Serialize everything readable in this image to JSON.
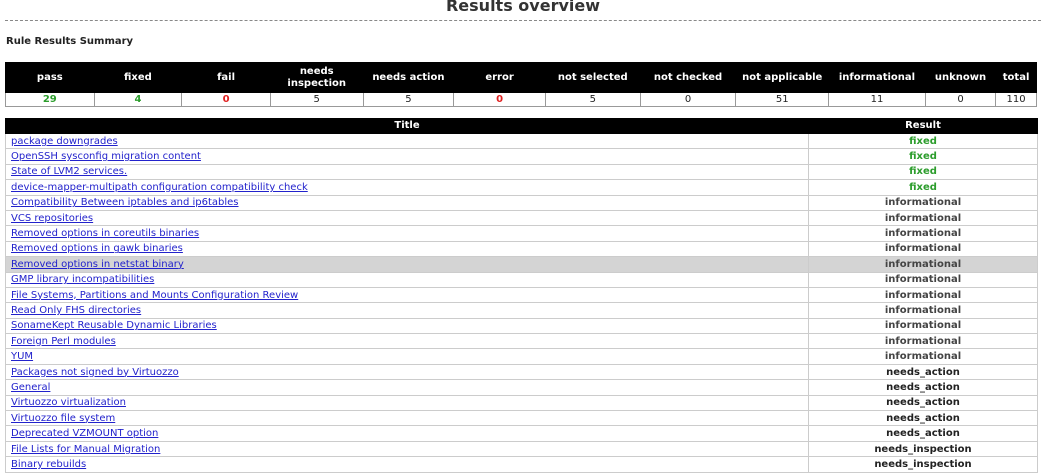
{
  "page": {
    "title": "Results overview"
  },
  "summary": {
    "title": "Rule Results Summary",
    "headers": [
      "pass",
      "fixed",
      "fail",
      "needs inspection",
      "needs action",
      "error",
      "not selected",
      "not checked",
      "not applicable",
      "informational",
      "unknown",
      "total"
    ],
    "values": [
      "29",
      "4",
      "0",
      "5",
      "5",
      "0",
      "5",
      "0",
      "51",
      "11",
      "0",
      "110"
    ],
    "colors": {
      "green": "#2c9d2c",
      "red": "#e02020"
    }
  },
  "results": {
    "headers": {
      "title": "Title",
      "result": "Result"
    },
    "rows": [
      {
        "title": "package downgrades",
        "result": "fixed"
      },
      {
        "title": "OpenSSH sysconfig migration content",
        "result": "fixed"
      },
      {
        "title": "State of LVM2 services.",
        "result": "fixed"
      },
      {
        "title": "device-mapper-multipath configuration compatibility check",
        "result": "fixed"
      },
      {
        "title": "Compatibility Between iptables and ip6tables",
        "result": "informational"
      },
      {
        "title": "VCS repositories",
        "result": "informational"
      },
      {
        "title": "Removed options in coreutils binaries",
        "result": "informational"
      },
      {
        "title": "Removed options in gawk binaries",
        "result": "informational"
      },
      {
        "title": "Removed options in netstat binary",
        "result": "informational",
        "highlighted": true
      },
      {
        "title": "GMP library incompatibilities",
        "result": "informational"
      },
      {
        "title": "File Systems, Partitions and Mounts Configuration Review",
        "result": "informational"
      },
      {
        "title": "Read Only FHS directories",
        "result": "informational"
      },
      {
        "title": "SonameKept Reusable Dynamic Libraries",
        "result": "informational"
      },
      {
        "title": "Foreign Perl modules",
        "result": "informational"
      },
      {
        "title": "YUM",
        "result": "informational"
      },
      {
        "title": "Packages not signed by Virtuozzo",
        "result": "needs_action"
      },
      {
        "title": "General",
        "result": "needs_action"
      },
      {
        "title": "Virtuozzo virtualization",
        "result": "needs_action"
      },
      {
        "title": "Virtuozzo file system",
        "result": "needs_action"
      },
      {
        "title": "Deprecated VZMOUNT option",
        "result": "needs_action"
      },
      {
        "title": "File Lists for Manual Migration",
        "result": "needs_inspection"
      },
      {
        "title": "Binary rebuilds",
        "result": "needs_inspection"
      }
    ]
  }
}
